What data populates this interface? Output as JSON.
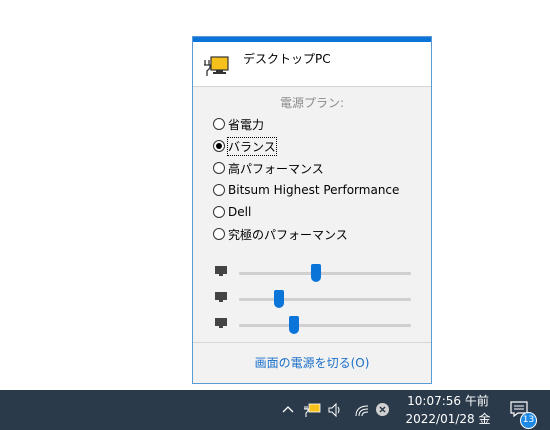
{
  "flyout": {
    "device_name": "デスクトップPC",
    "plans_heading": "電源プラン:",
    "plans": [
      {
        "label": "省電力",
        "checked": false
      },
      {
        "label": "バランス",
        "checked": true
      },
      {
        "label": "高パフォーマンス",
        "checked": false
      },
      {
        "label": "Bitsum Highest Performance",
        "checked": false
      },
      {
        "label": "Dell",
        "checked": false
      },
      {
        "label": "究極のパフォーマンス",
        "checked": false
      }
    ],
    "brightness_levels": [
      0.45,
      0.23,
      0.32
    ],
    "turn_off_label": "画面の電源を切る(O)",
    "accent_color": "#0a74d8"
  },
  "taskbar": {
    "time": "10:07:56 午前",
    "date": "2022/01/28 金",
    "notification_count": "13",
    "icons": [
      "chevron-up-icon",
      "power-plug-icon",
      "speaker-icon",
      "wifi-icon",
      "close-circle-icon",
      "notification-icon"
    ]
  }
}
